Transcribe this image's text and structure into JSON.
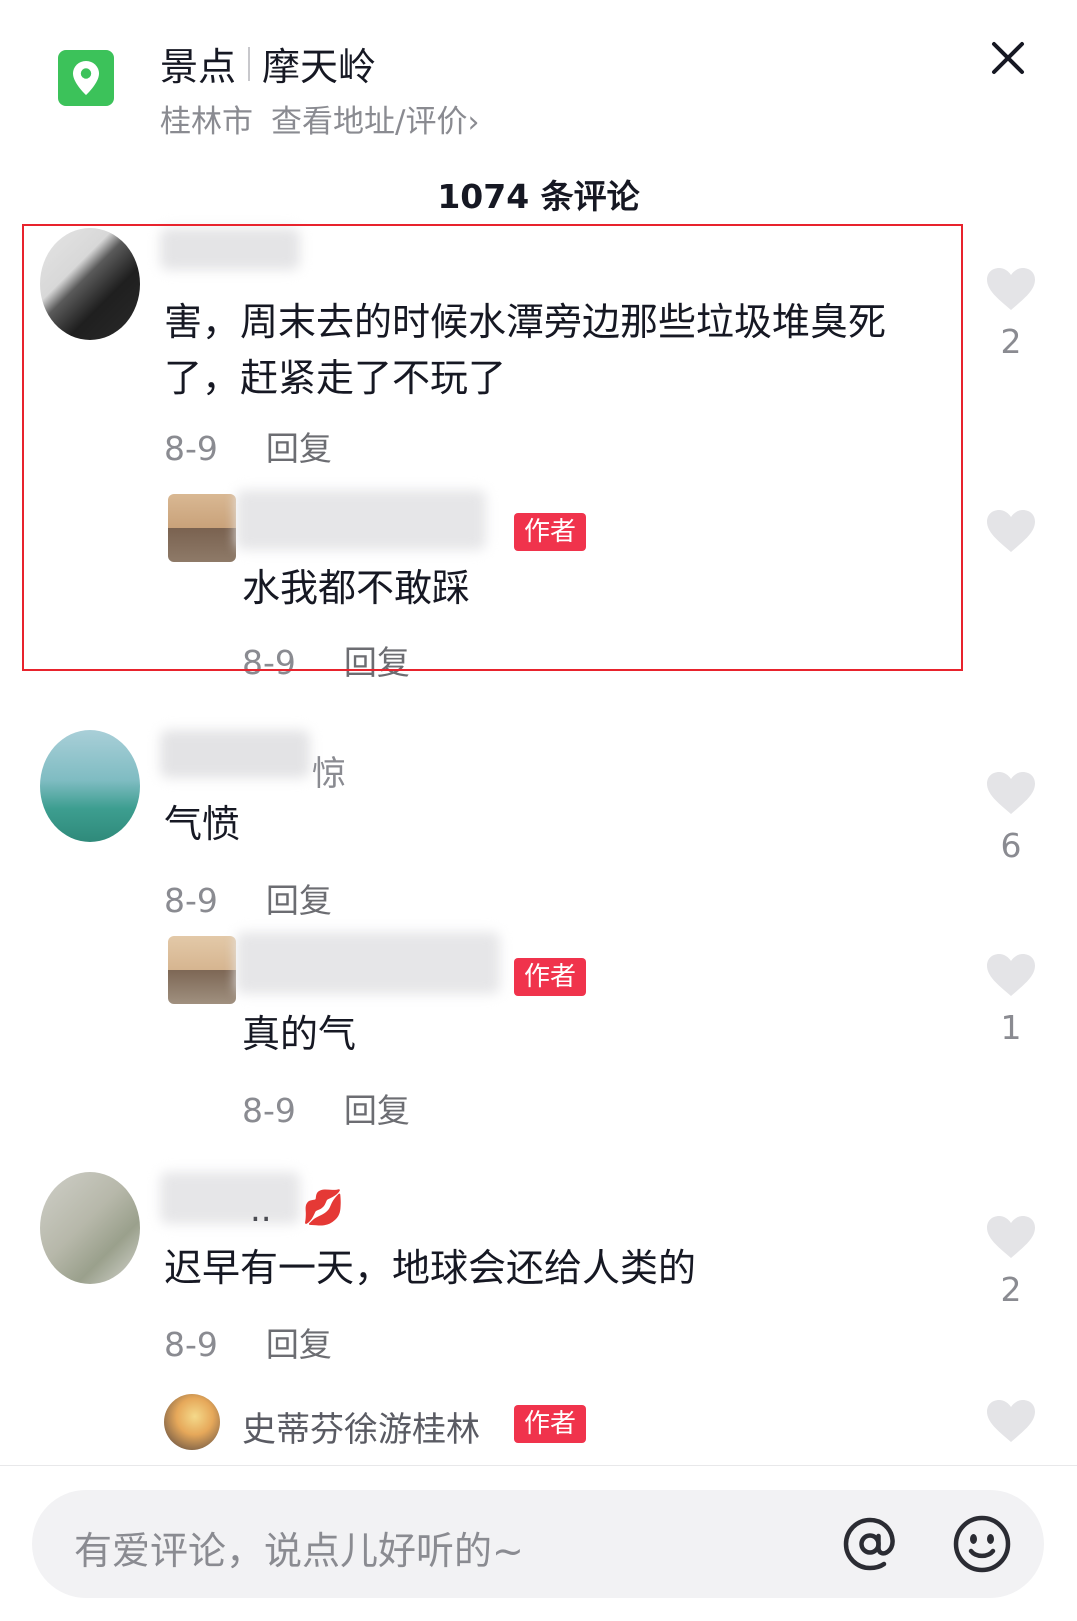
{
  "header": {
    "category": "景点",
    "place": "摩天岭",
    "city": "桂林市",
    "link": "查看地址/评价",
    "chevron": "›"
  },
  "comments_count": "1074 条评论",
  "comments": [
    {
      "text": "害，周末去的时候水潭旁边那些垃圾堆臭死了，赶紧走了不玩了",
      "date": "8-9",
      "reply": "回复",
      "likes": "2",
      "replies": [
        {
          "badge": "作者",
          "text": "水我都不敢踩",
          "date": "8-9",
          "reply": "回复"
        }
      ]
    },
    {
      "name_suffix": "惊",
      "text": "气愤",
      "date": "8-9",
      "reply": "回复",
      "likes": "6",
      "replies": [
        {
          "badge": "作者",
          "text": "真的气",
          "date": "8-9",
          "reply": "回复",
          "likes": "1"
        }
      ]
    },
    {
      "name_suffix": "..",
      "name_emoji": "💋",
      "text": "迟早有一天，地球会还给人类的",
      "date": "8-9",
      "reply": "回复",
      "likes": "2",
      "replies": [
        {
          "name": "史蒂芬徐游桂林",
          "badge": "作者"
        }
      ]
    }
  ],
  "input": {
    "placeholder": "有爱评论，说点儿好听的~"
  },
  "colors": {
    "location_icon": "#3cc25a",
    "author_badge": "#f0334c",
    "highlight_box": "#e8232d"
  }
}
